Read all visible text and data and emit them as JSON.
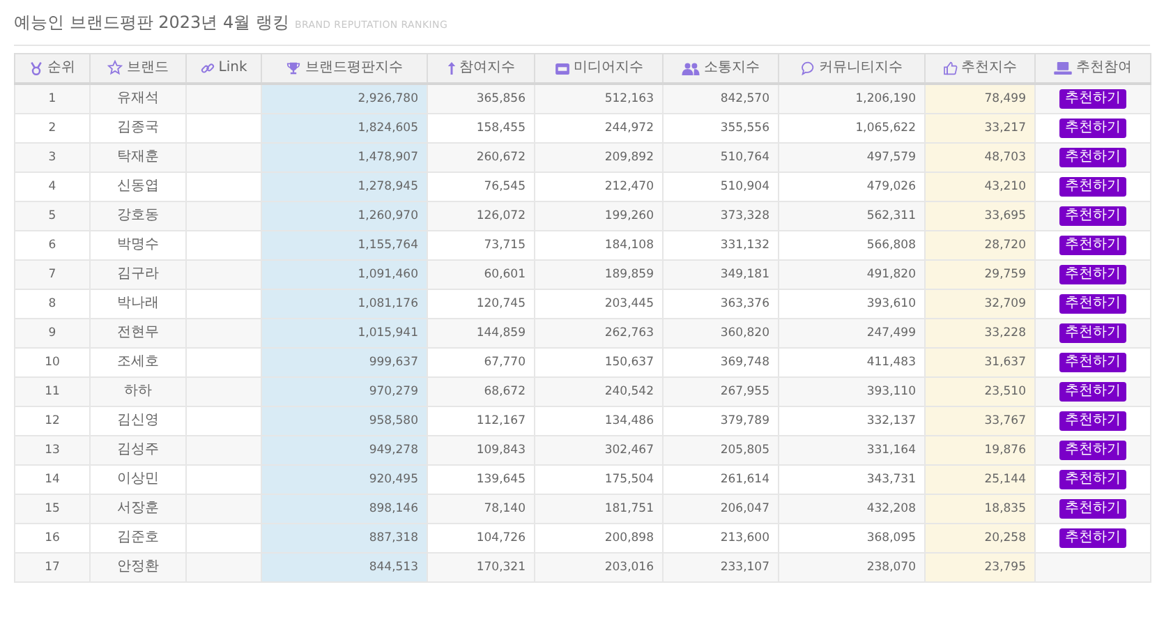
{
  "page": {
    "title": "예능인 브랜드평판 2023년 4월 랭킹",
    "subtitle": "BRAND REPUTATION RANKING"
  },
  "table": {
    "columns": [
      {
        "label": "순위"
      },
      {
        "label": "브랜드"
      },
      {
        "label": "Link"
      },
      {
        "label": "브랜드평판지수",
        "color": "#d9ebf5"
      },
      {
        "label": "참여지수"
      },
      {
        "label": "미디어지수"
      },
      {
        "label": "소통지수"
      },
      {
        "label": "커뮤니티지수"
      },
      {
        "label": "추천지수",
        "color": "#fcf6e1"
      },
      {
        "label": "추천참여"
      }
    ],
    "rows": [
      {
        "rank": "1",
        "name": "유재석",
        "brand": "2,926,780",
        "participation": "365,856",
        "media": "512,163",
        "communication": "842,570",
        "community": "1,206,190",
        "recommend": "78,499",
        "button": "추천하기"
      },
      {
        "rank": "2",
        "name": "김종국",
        "brand": "1,824,605",
        "participation": "158,455",
        "media": "244,972",
        "communication": "355,556",
        "community": "1,065,622",
        "recommend": "33,217",
        "button": "추천하기"
      },
      {
        "rank": "3",
        "name": "탁재훈",
        "brand": "1,478,907",
        "participation": "260,672",
        "media": "209,892",
        "communication": "510,764",
        "community": "497,579",
        "recommend": "48,703",
        "button": "추천하기"
      },
      {
        "rank": "4",
        "name": "신동엽",
        "brand": "1,278,945",
        "participation": "76,545",
        "media": "212,470",
        "communication": "510,904",
        "community": "479,026",
        "recommend": "43,210",
        "button": "추천하기"
      },
      {
        "rank": "5",
        "name": "강호동",
        "brand": "1,260,970",
        "participation": "126,072",
        "media": "199,260",
        "communication": "373,328",
        "community": "562,311",
        "recommend": "33,695",
        "button": "추천하기"
      },
      {
        "rank": "6",
        "name": "박명수",
        "brand": "1,155,764",
        "participation": "73,715",
        "media": "184,108",
        "communication": "331,132",
        "community": "566,808",
        "recommend": "28,720",
        "button": "추천하기"
      },
      {
        "rank": "7",
        "name": "김구라",
        "brand": "1,091,460",
        "participation": "60,601",
        "media": "189,859",
        "communication": "349,181",
        "community": "491,820",
        "recommend": "29,759",
        "button": "추천하기"
      },
      {
        "rank": "8",
        "name": "박나래",
        "brand": "1,081,176",
        "participation": "120,745",
        "media": "203,445",
        "communication": "363,376",
        "community": "393,610",
        "recommend": "32,709",
        "button": "추천하기"
      },
      {
        "rank": "9",
        "name": "전현무",
        "brand": "1,015,941",
        "participation": "144,859",
        "media": "262,763",
        "communication": "360,820",
        "community": "247,499",
        "recommend": "33,228",
        "button": "추천하기"
      },
      {
        "rank": "10",
        "name": "조세호",
        "brand": "999,637",
        "participation": "67,770",
        "media": "150,637",
        "communication": "369,748",
        "community": "411,483",
        "recommend": "31,637",
        "button": "추천하기"
      },
      {
        "rank": "11",
        "name": "하하",
        "brand": "970,279",
        "participation": "68,672",
        "media": "240,542",
        "communication": "267,955",
        "community": "393,110",
        "recommend": "23,510",
        "button": "추천하기"
      },
      {
        "rank": "12",
        "name": "김신영",
        "brand": "958,580",
        "participation": "112,167",
        "media": "134,486",
        "communication": "379,789",
        "community": "332,137",
        "recommend": "33,767",
        "button": "추천하기"
      },
      {
        "rank": "13",
        "name": "김성주",
        "brand": "949,278",
        "participation": "109,843",
        "media": "302,467",
        "communication": "205,805",
        "community": "331,164",
        "recommend": "19,876",
        "button": "추천하기"
      },
      {
        "rank": "14",
        "name": "이상민",
        "brand": "920,495",
        "participation": "139,645",
        "media": "175,504",
        "communication": "261,614",
        "community": "343,731",
        "recommend": "25,144",
        "button": "추천하기"
      },
      {
        "rank": "15",
        "name": "서장훈",
        "brand": "898,146",
        "participation": "78,140",
        "media": "181,751",
        "communication": "206,047",
        "community": "432,208",
        "recommend": "18,835",
        "button": "추천하기"
      },
      {
        "rank": "16",
        "name": "김준호",
        "brand": "887,318",
        "participation": "104,726",
        "media": "200,898",
        "communication": "213,600",
        "community": "368,095",
        "recommend": "20,258",
        "button": "추천하기"
      },
      {
        "rank": "17",
        "name": "안정환",
        "brand": "844,513",
        "participation": "170,321",
        "media": "203,016",
        "communication": "233,107",
        "community": "238,070",
        "recommend": "23,795"
      }
    ]
  }
}
